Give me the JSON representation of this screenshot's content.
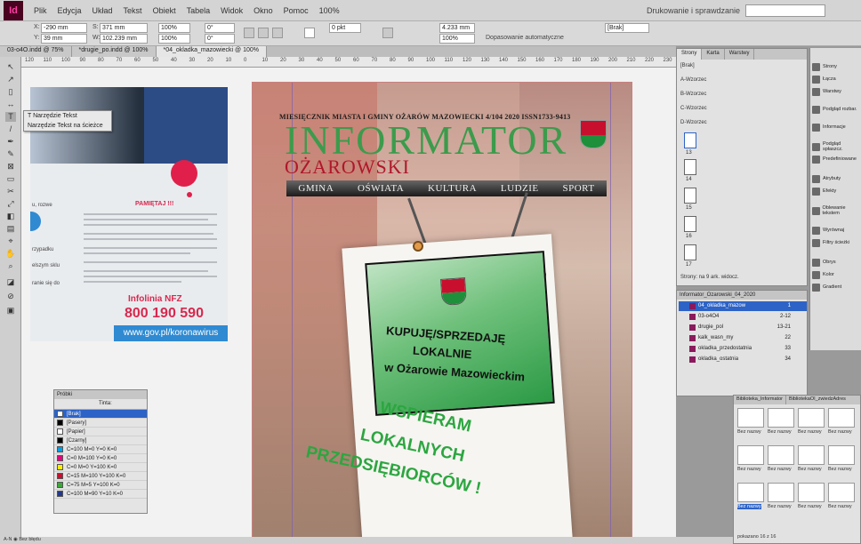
{
  "app": {
    "logo": "Id",
    "menu": [
      "Plik",
      "Edycja",
      "Układ",
      "Tekst",
      "Obiekt",
      "Tabela",
      "Widok",
      "Okno",
      "Pomoc"
    ],
    "zoom": "100%",
    "workspace": "Drukowanie i sprawdzanie"
  },
  "control": {
    "x": "-290 mm",
    "y": "39 mm",
    "w": "371 mm",
    "h": "102.239 mm",
    "scale_x": "100%",
    "scale_y": "100%",
    "rotate": "0°",
    "shear": "0°",
    "stroke": "0 pkt",
    "fit_w": "4.233 mm",
    "fit_pct": "100%",
    "autofit": "Dopasowanie automatyczne",
    "style": "[Brak]"
  },
  "tabs": [
    {
      "label": "03-o4O.indd @ 75%",
      "active": false
    },
    {
      "label": "*drugie_po.indd @ 100%",
      "active": false
    },
    {
      "label": "*04_okladka_mazowiecki @ 100%",
      "active": true
    }
  ],
  "ruler_ticks": [
    "120",
    "110",
    "100",
    "90",
    "80",
    "70",
    "60",
    "50",
    "40",
    "30",
    "20",
    "10",
    "0",
    "10",
    "20",
    "30",
    "40",
    "50",
    "60",
    "70",
    "80",
    "90",
    "100",
    "110",
    "120",
    "130",
    "140",
    "150",
    "160",
    "170",
    "180",
    "190",
    "200",
    "210",
    "220",
    "230"
  ],
  "tool_flyout": [
    {
      "label": "T  Narzędzie Tekst",
      "shortcut": "T"
    },
    {
      "label": "Narzędzie Tekst na ścieżce",
      "shortcut": "Shift+T"
    }
  ],
  "left_page": {
    "notice_title": "PAMIĘTAJ !!!",
    "nfz_title": "Infolinia NFZ",
    "nfz_phone": "800 190 590",
    "gov_url": "www.gov.pl/koronawirus",
    "cut_texts": [
      "u, rozwe",
      "rzypadku",
      "elszym sklu",
      "ranie się do"
    ]
  },
  "cover": {
    "header": "MIESIĘCZNIK MIASTA I GMINY OŻARÓW MAZOWIECKI  4/104 2020     ISSN1733-9413",
    "title": "INFORMATOR",
    "subtitle": "OŻAROWSKI",
    "nav": [
      "GMINA",
      "OŚWIATA",
      "KULTURA",
      "LUDZIE",
      "SPORT"
    ],
    "sign_line1": "KUPUJĘ/SPRZEDAJĘ",
    "sign_line2": "LOKALNIE",
    "sign_line3": "w Ożarowie Mazowieckim",
    "slogan": [
      "WSPIERAM",
      "LOKALNYCH",
      "PRZEDSIĘBIORCÓW !"
    ],
    "colors": {
      "title": "#3c9b4c",
      "subtitle": "#b0172b",
      "slogan": "#2ca640"
    }
  },
  "swatches": {
    "title": "Próbki",
    "tint_label": "Tinta:",
    "items": [
      {
        "name": "[Brak]",
        "color": "#ffffff",
        "selected": true
      },
      {
        "name": "[Pasery]",
        "color": "#000000",
        "selected": false
      },
      {
        "name": "[Papier]",
        "color": "#ffffff",
        "selected": false
      },
      {
        "name": "[Czarny]",
        "color": "#000000",
        "selected": false
      },
      {
        "name": "C=100 M=0 Y=0 K=0",
        "color": "#00a0e3",
        "selected": false
      },
      {
        "name": "C=0 M=100 Y=0 K=0",
        "color": "#e5007e",
        "selected": false
      },
      {
        "name": "C=0 M=0 Y=100 K=0",
        "color": "#ffed00",
        "selected": false
      },
      {
        "name": "C=15 M=100 Y=100 K=0",
        "color": "#c8102e",
        "selected": false
      },
      {
        "name": "C=75 M=5 Y=100 K=0",
        "color": "#3aa935",
        "selected": false
      },
      {
        "name": "C=100 M=90 Y=10 K=0",
        "color": "#233a8c",
        "selected": false
      }
    ]
  },
  "pages_panel": {
    "tabs": [
      "Strony",
      "Karta",
      "Warstwy"
    ],
    "masters": [
      "[Brak]",
      "A-Wzorzec",
      "B-Wzorzec",
      "C-Wzorzec",
      "D-Wzorzec"
    ],
    "pages": [
      "13",
      "14",
      "15",
      "16",
      "17"
    ],
    "status": "Strony: na 9 ark. widocz."
  },
  "layers_panel": {
    "title": "Informator_Ozarowski_04_2020",
    "items": [
      {
        "name": "04_okladka_mazow",
        "num": "1",
        "selected": true
      },
      {
        "name": "03-o4O4",
        "num": "2-12",
        "selected": false
      },
      {
        "name": "drugie_pol",
        "num": "13-21",
        "selected": false
      },
      {
        "name": "kalk_wasn_my",
        "num": "22",
        "selected": false
      },
      {
        "name": "okladka_przedostatnia",
        "num": "33",
        "selected": false
      },
      {
        "name": "okladka_ostatnia",
        "num": "34",
        "selected": false
      }
    ]
  },
  "library": {
    "tabs": [
      "Biblioteka_Informator",
      "BibliotekaOI_zwiedzAdres"
    ],
    "labels": [
      "Bez nazwy",
      "Bez nazwy",
      "Bez nazwy",
      "Bez nazwy",
      "Bez nazwy",
      "Bez nazwy",
      "Bez nazwy",
      "Bez nazwy",
      "Bez nazwy",
      "Bez nazwy",
      "Bez nazwy",
      "Bez nazwy"
    ],
    "status": "pokazano 16 z 16"
  },
  "dock": [
    "Strony",
    "Łącza",
    "Warstwy",
    "Podgląd rozbar.",
    "Informacje",
    "Podgląd spłaszcz.",
    "Predefiniowane",
    "Atrybuty",
    "Efekty",
    "Oblewanie tekstem",
    "Wyrównaj",
    "Filtry ścieżki",
    "Obrys",
    "Kolor",
    "Gradient"
  ],
  "status": "A-N  ◉  Bez błędu"
}
